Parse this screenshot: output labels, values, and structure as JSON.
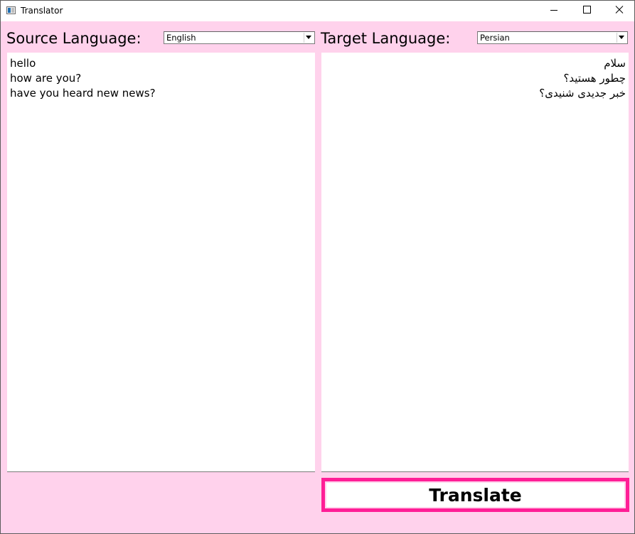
{
  "window": {
    "title": "Translator",
    "controls": {
      "minimize_icon": "minimize-icon",
      "maximize_icon": "maximize-icon",
      "close_icon": "close-icon"
    }
  },
  "source": {
    "label": "Source Language:",
    "selected_language": "English",
    "lines": [
      "hello",
      "how are you?",
      "have you heard new news?"
    ]
  },
  "target": {
    "label": "Target Language:",
    "selected_language": "Persian",
    "lines": [
      "سلام",
      "چطور هستید؟",
      "خبر جدیدی شنیدی؟"
    ]
  },
  "actions": {
    "translate_label": "Translate"
  },
  "colors": {
    "background": "#ffd2ec",
    "button_border": "#ff1e96",
    "text_area": "#ffffff"
  }
}
